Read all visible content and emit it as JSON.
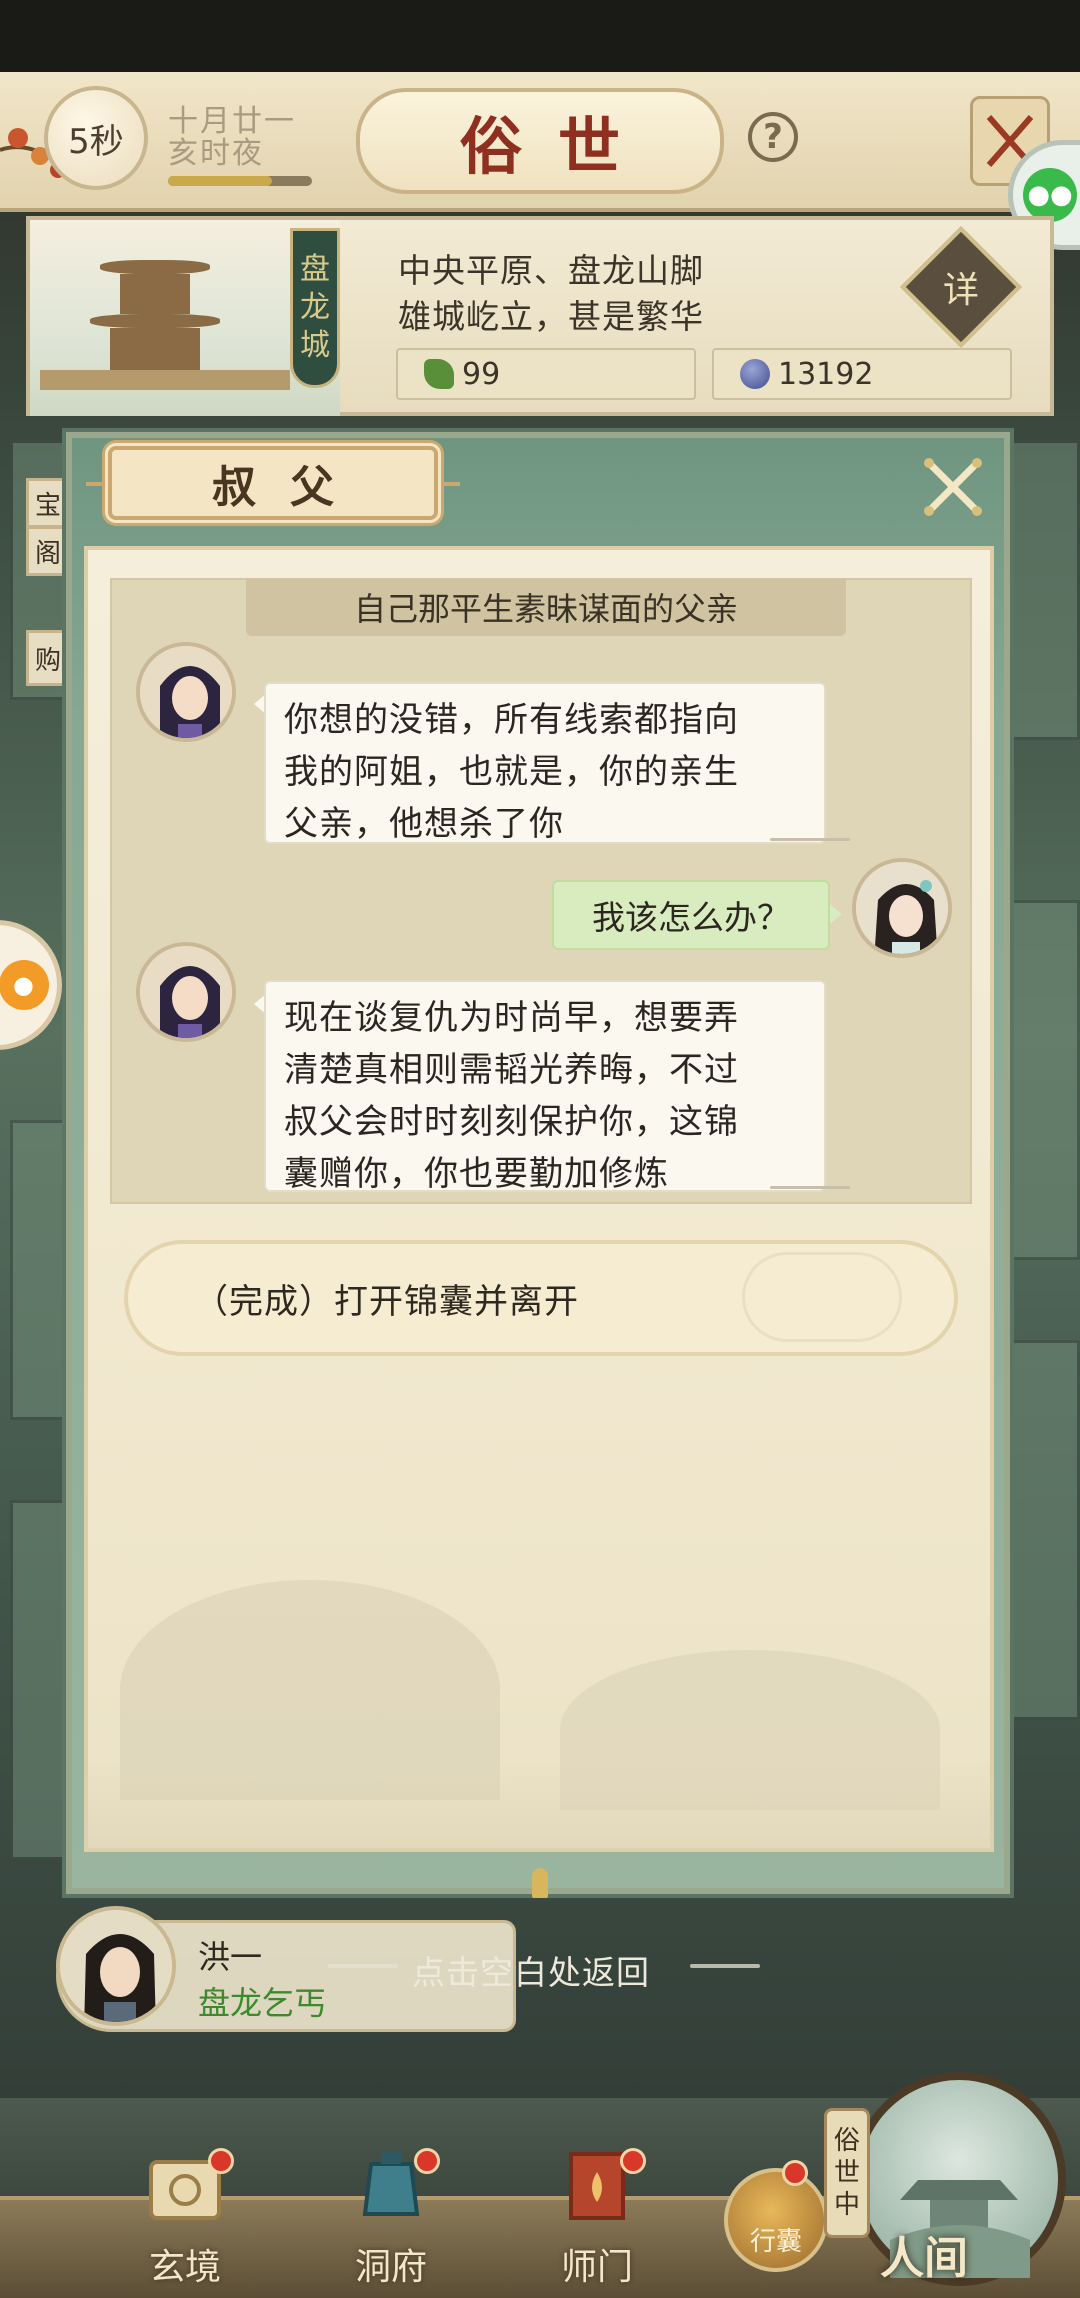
{
  "header": {
    "timer": "5秒",
    "date_line1": "十月廿一",
    "date_line2": "亥时夜",
    "day_progress": 0.72,
    "title": "俗世",
    "help_label": "?"
  },
  "location": {
    "city_name": "盘龙城",
    "city_chars": [
      "盘",
      "龙",
      "城"
    ],
    "line1": "中央平原、盘龙山脚",
    "line2": "雄城屹立，甚是繁华",
    "detail_label": "详",
    "jade_count": "99",
    "coin_count": "13192"
  },
  "side_tabs": [
    "宝",
    "阁",
    "购"
  ],
  "dialog": {
    "title": "叔父",
    "chat_header": "自己那平生素昧谋面的父亲",
    "messages": [
      {
        "speaker": "uncle",
        "side": "left",
        "text_lines": [
          "你想的没错，所有线索都指向",
          "我的阿姐，也就是，你的亲生",
          "父亲，他想杀了你"
        ]
      },
      {
        "speaker": "player",
        "side": "right",
        "text_lines": [
          "我该怎么办？"
        ]
      },
      {
        "speaker": "uncle",
        "side": "left",
        "text_lines": [
          "现在谈复仇为时尚早，想要弄",
          "清楚真相则需韬光养晦，不过",
          "叔父会时时刻刻保护你，这锦",
          "囊赠你，你也要勤加修炼"
        ]
      }
    ],
    "choice": "（完成）打开锦囊并离开"
  },
  "npc": {
    "name": "洪一",
    "title": "盘龙乞丐"
  },
  "return_hint": "点击空白处返回",
  "nav": {
    "items": [
      {
        "label": "玄境",
        "badge": true
      },
      {
        "label": "洞府",
        "badge": true
      },
      {
        "label": "师门",
        "badge": true
      }
    ],
    "bag_label": "行囊",
    "world_tag": [
      "俗",
      "世",
      "中"
    ],
    "world_label": "人间"
  },
  "colors": {
    "title_red": "#8f2f1f",
    "npc_title_green": "#3d8a2e",
    "player_bubble": "#d8ecc0",
    "dialog_frame": "#88a893",
    "badge_red": "#d9372a"
  }
}
